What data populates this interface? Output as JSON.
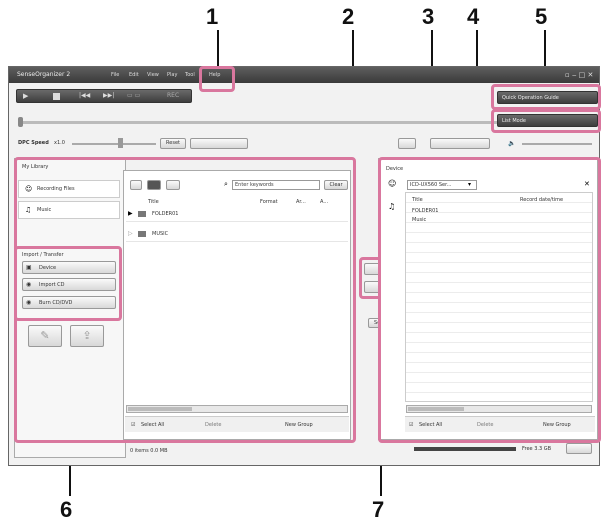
{
  "callouts": [
    "1",
    "2",
    "3",
    "4",
    "5",
    "6",
    "7"
  ],
  "app": {
    "title": "SenseOrganizer 2",
    "menus": [
      "File",
      "Edit",
      "View",
      "Play",
      "Tool",
      "Help"
    ]
  },
  "toolbar": {
    "quick_guide": "Quick Operation Guide",
    "list_mode": "List Mode",
    "dpc_label": "DPC Speed",
    "dpc_value": "x1.0",
    "reset": "Reset"
  },
  "library": {
    "title": "My Library",
    "nav": [
      "Recording Files",
      "Music"
    ],
    "search_placeholder": "Enter keywords",
    "clear": "Clear",
    "columns": [
      "Title",
      "Format",
      "Ar...",
      "A..."
    ],
    "folders": [
      "FOLDER01",
      "MUSIC"
    ],
    "select_all": "Select All",
    "delete": "Delete",
    "new_group": "New Group",
    "status": "0 items 0.0 MB"
  },
  "import": {
    "title": "Import / Transfer",
    "items": [
      "Device",
      "Import CD",
      "Burn CD/DVD"
    ]
  },
  "device": {
    "title": "Device",
    "selector": "ICD-UX560 Ser...",
    "columns": [
      "Title",
      "Record date/time"
    ],
    "folders": [
      "FOLDER01",
      "Music"
    ],
    "select_all": "Select All",
    "delete": "Delete",
    "new_group": "New Group",
    "settings": "Setting",
    "status": "Free 3.3 GB"
  },
  "colors": {
    "highlight": "#d9779e",
    "titlebar": "#3a3a3a"
  }
}
